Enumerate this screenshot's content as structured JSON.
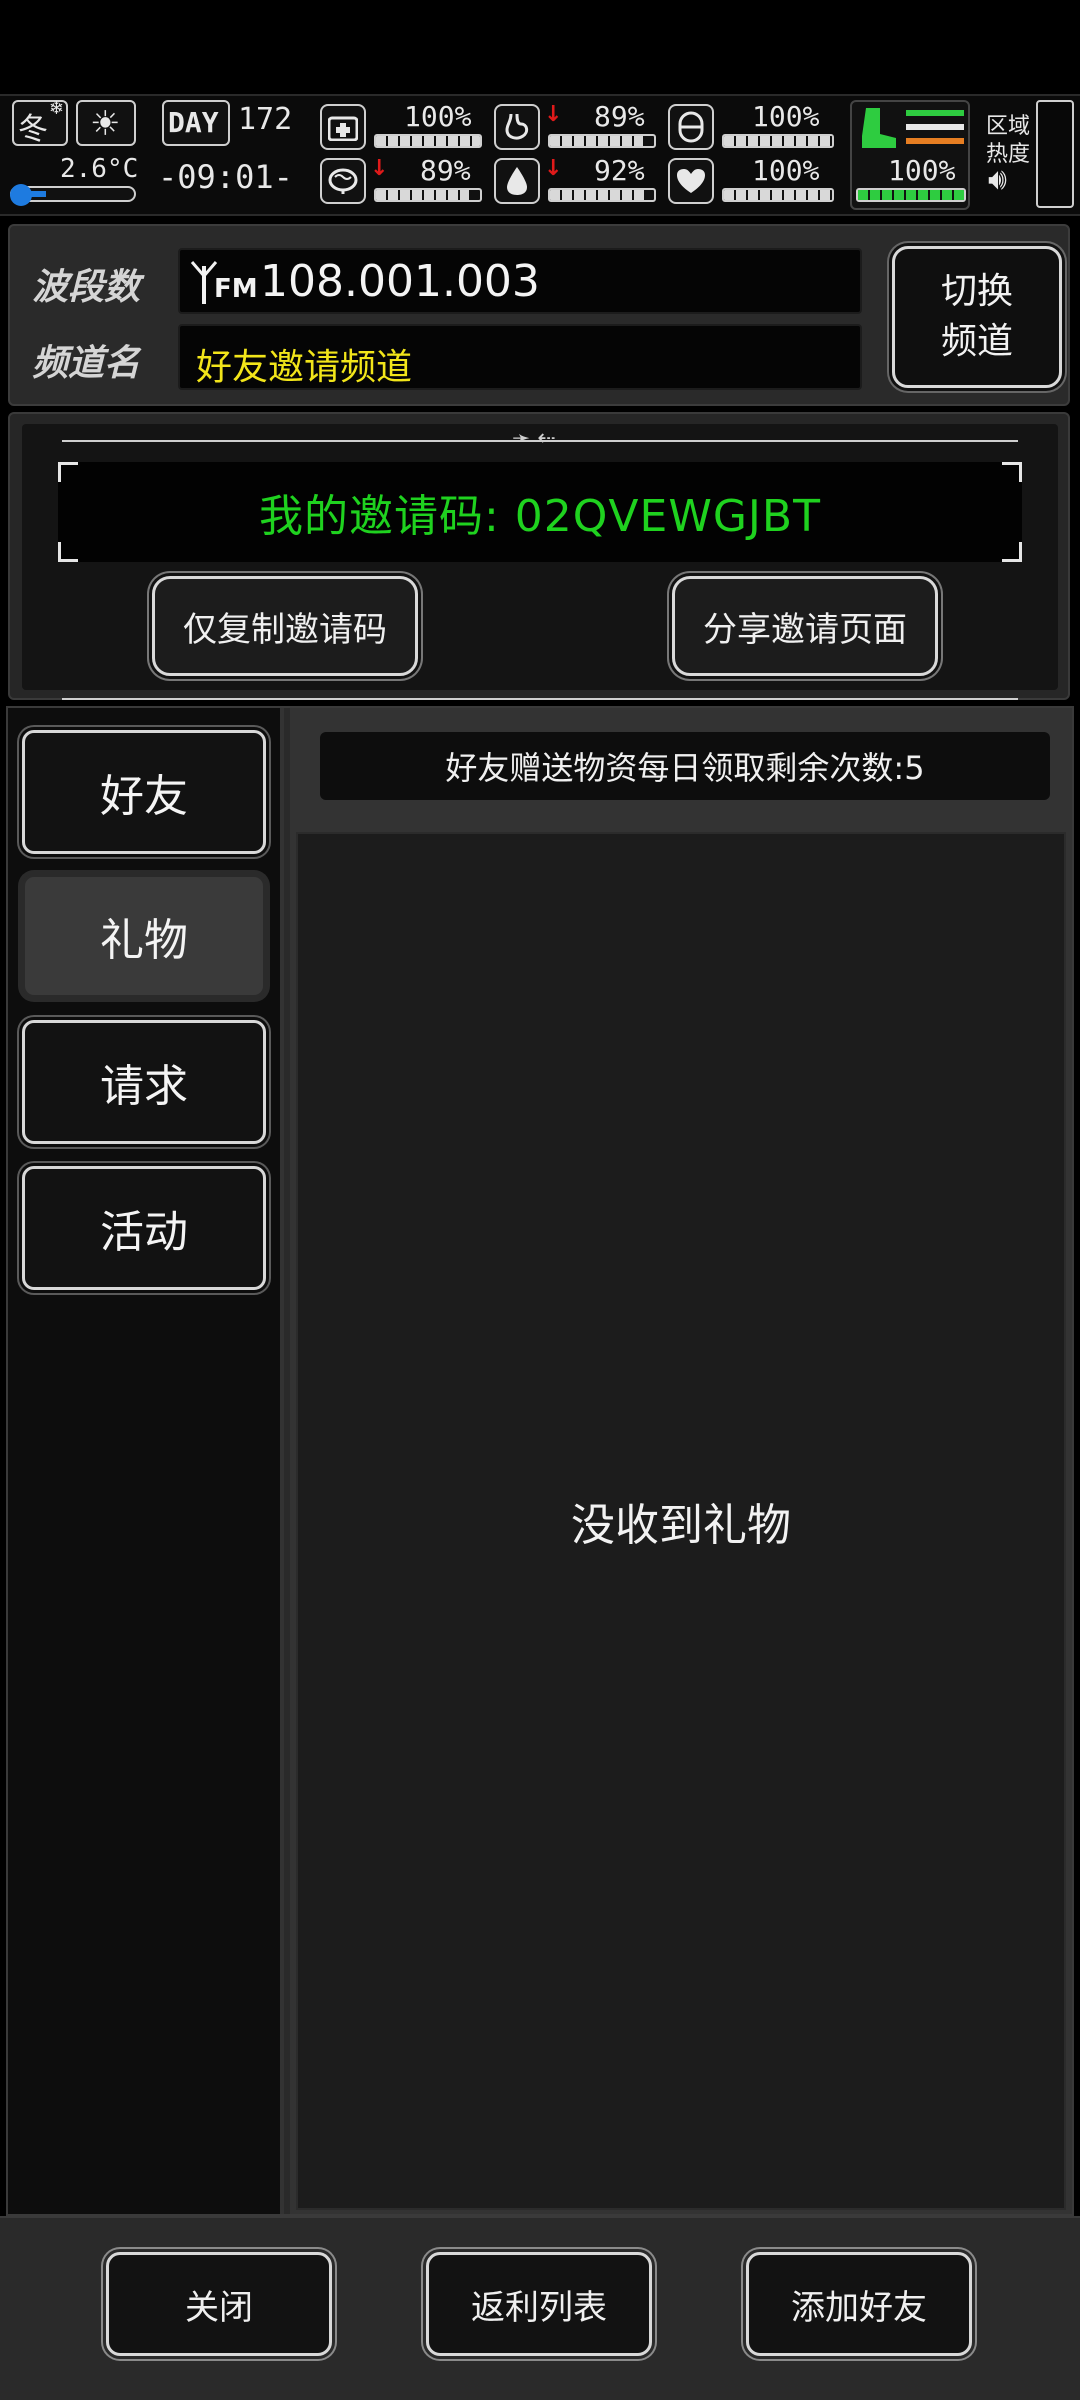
{
  "status": {
    "season": "冬",
    "temperature": "2.6°C",
    "day_label": "DAY",
    "day_number": "172",
    "time": "-09:01-",
    "health_percent": "100%",
    "stomach_percent": "89%",
    "capsule_percent": "100%",
    "brain_percent": "89%",
    "water_percent": "92%",
    "heart_percent": "100%",
    "stamina_percent": "100%",
    "region_heat_label_1": "区域",
    "region_heat_label_2": "热度",
    "levels": {
      "health": 1.0,
      "stomach": 0.89,
      "capsule": 1.0,
      "brain": 0.89,
      "water": 0.92,
      "heart": 1.0,
      "stamina": 1.0
    }
  },
  "radio": {
    "band_label": "波段数",
    "band_value": "108.001.003",
    "fm_label": "FM",
    "channel_label": "频道名",
    "channel_value": "好友邀请频道",
    "switch_line1": "切换",
    "switch_line2": "频道"
  },
  "invite": {
    "code_text": "我的邀请码: 02QVEWGJBT",
    "copy_button": "仅复制邀请码",
    "share_button": "分享邀请页面"
  },
  "tabs": [
    {
      "label": "好友"
    },
    {
      "label": "礼物"
    },
    {
      "label": "请求"
    },
    {
      "label": "活动"
    }
  ],
  "content": {
    "counter_text": "好友赠送物资每日领取剩余次数:5",
    "empty_text": "没收到礼物"
  },
  "bottom": {
    "close": "关闭",
    "rebate": "返利列表",
    "add_friend": "添加好友"
  },
  "colors": {
    "invite_code": "#1fd21f",
    "channel_name": "#f2e51a",
    "alert_arrow": "#e01a1a",
    "stamina_green": "#2ecc40"
  }
}
